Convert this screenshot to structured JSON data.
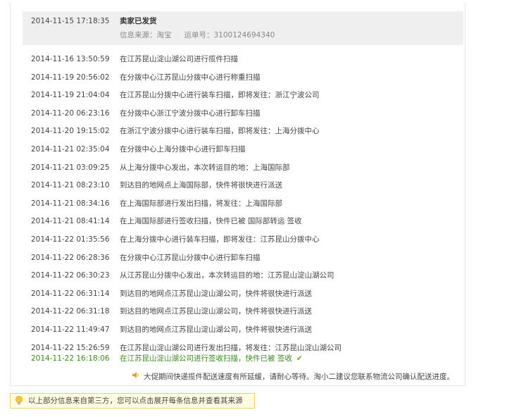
{
  "first": {
    "time": "2014-11-15 17:18:35",
    "title": "卖家已发货",
    "source_label": "信息来源：淘宝",
    "waybill_label": "运单号：3100124694340"
  },
  "events": [
    {
      "time": "2014-11-16 13:50:59",
      "desc": "在江苏昆山淀山湖公司进行揽件扫描"
    },
    {
      "time": "2014-11-19 20:56:02",
      "desc": "在分拨中心江苏昆山分拨中心进行称重扫描"
    },
    {
      "time": "2014-11-19 21:04:04",
      "desc": "在江苏昆山分拨中心进行装车扫描，即将发往：浙江宁波公司"
    },
    {
      "time": "2014-11-20 06:23:16",
      "desc": "在分拨中心浙江宁波分拨中心进行卸车扫描"
    },
    {
      "time": "2014-11-20 19:15:02",
      "desc": "在浙江宁波分拨中心进行装车扫描，即将发往：上海分拨中心"
    },
    {
      "time": "2014-11-21 02:35:04",
      "desc": "在分拨中心上海分拨中心进行卸车扫描"
    },
    {
      "time": "2014-11-21 03:09:25",
      "desc": "从上海分拨中心发出，本次转运目的地：上海国际部"
    },
    {
      "time": "2014-11-21 08:23:10",
      "desc": "到达目的地网点上海国际部，快件将很快进行派送"
    },
    {
      "time": "2014-11-21 08:34:16",
      "desc": "在上海国际部进行发出扫描，将发往：上海国际部"
    },
    {
      "time": "2014-11-21 08:41:14",
      "desc": "在上海国际部进行签收扫描，快件已被 国际部转运 签收"
    },
    {
      "time": "2014-11-22 01:35:56",
      "desc": "在上海分拨中心进行装车扫描，即将发往：江苏昆山分拨中心"
    },
    {
      "time": "2014-11-22 06:28:36",
      "desc": "在分拨中心江苏昆山分拨中心进行卸车扫描"
    },
    {
      "time": "2014-11-22 06:30:23",
      "desc": "从江苏昆山分拨中心发出，本次转运目的地：江苏昆山淀山湖公司"
    },
    {
      "time": "2014-11-22 06:31:14",
      "desc": "到达目的地网点江苏昆山淀山湖公司，快件将很快进行派送"
    },
    {
      "time": "2014-11-22 06:31:18",
      "desc": "到达目的地网点江苏昆山淀山湖公司，快件将很快进行派送"
    },
    {
      "time": "2014-11-22 11:49:47",
      "desc": "到达目的地网点江苏昆山淀山湖公司，快件将很快进行派送"
    },
    {
      "time": "2014-11-22 15:26:59",
      "desc": "在江苏昆山淀山湖公司进行发出扫描，将发往：江苏昆山淀山湖公司"
    }
  ],
  "last": {
    "time": "2014-11-22 16:18:06",
    "desc": "在江苏昆山淀山湖公司进行签收扫描，快件已被 签收",
    "check_icon": "check-icon",
    "highlight_color": "#3b8a1f"
  },
  "notice": {
    "icon": "speaker-icon",
    "text": "大促期间快递揽件配送速度有所延缓，请耐心等待。淘小二建议您联系物流公司确认配送进度。"
  },
  "tip": {
    "icon": "lightbulb-icon",
    "text": "以上部分信息来自第三方，您可以点击展开每条信息并查看其来源"
  }
}
